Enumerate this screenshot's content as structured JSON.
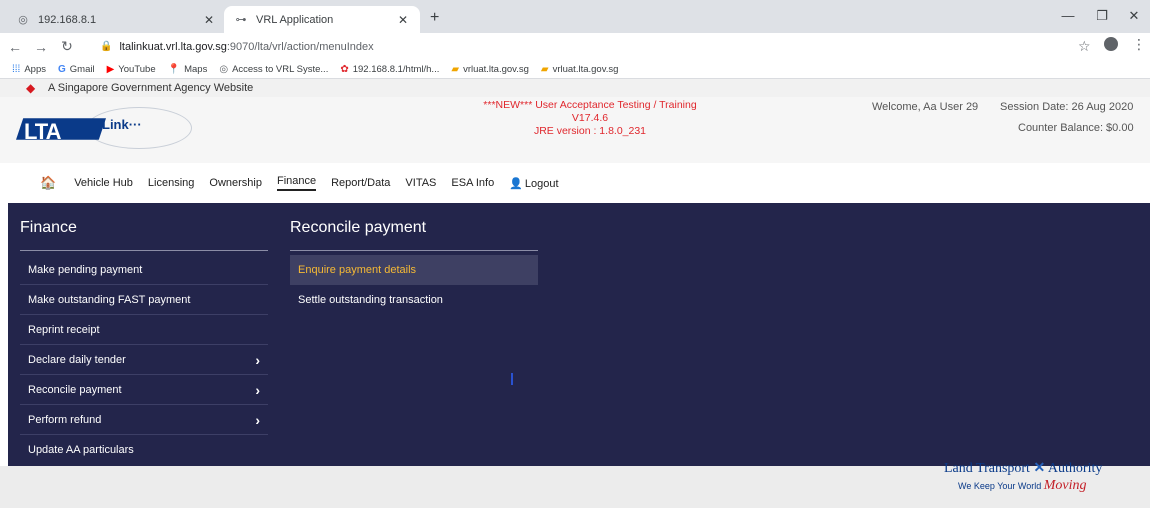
{
  "browser": {
    "tabs": [
      {
        "title": "192.168.8.1",
        "icon": "globe-icon"
      },
      {
        "title": "VRL Application",
        "icon": "key-icon"
      }
    ],
    "url_host": "ltalinkuat.vrl.lta.gov.sg",
    "url_path": ":9070/lta/vrl/action/menuIndex",
    "bookmarks": [
      {
        "label": "Apps",
        "icon": "apps-grid-icon"
      },
      {
        "label": "Gmail",
        "icon": "google-icon"
      },
      {
        "label": "YouTube",
        "icon": "youtube-icon"
      },
      {
        "label": "Maps",
        "icon": "maps-icon"
      },
      {
        "label": "Access to VRL Syste...",
        "icon": "globe-icon"
      },
      {
        "label": "192.168.8.1/html/h...",
        "icon": "huawei-icon"
      },
      {
        "label": "vrluat.lta.gov.sg",
        "icon": "lta-icon"
      },
      {
        "label": "vrluat.lta.gov.sg",
        "icon": "lta-icon"
      }
    ]
  },
  "header": {
    "gov_banner": "A Singapore Government Agency Website",
    "logo_text": "LTA",
    "logo_link": "Link···",
    "notice_line1": "***NEW*** User Acceptance Testing / Training",
    "notice_line2": "V17.4.6",
    "notice_line3": "JRE version : 1.8.0_231",
    "welcome": "Welcome, Aa User 29",
    "session_date": "Session Date: 26 Aug 2020",
    "counter_balance": "Counter Balance: $0.00"
  },
  "nav": {
    "items": [
      "Vehicle Hub",
      "Licensing",
      "Ownership",
      "Finance",
      "Report/Data",
      "VITAS",
      "ESA Info"
    ],
    "active": "Finance",
    "logout": "Logout"
  },
  "finance": {
    "title": "Finance",
    "items": [
      {
        "label": "Make pending payment",
        "has_submenu": false
      },
      {
        "label": "Make outstanding FAST payment",
        "has_submenu": false
      },
      {
        "label": "Reprint receipt",
        "has_submenu": false
      },
      {
        "label": "Declare daily tender",
        "has_submenu": true
      },
      {
        "label": "Reconcile payment",
        "has_submenu": true
      },
      {
        "label": "Perform refund",
        "has_submenu": true
      },
      {
        "label": "Update AA particulars",
        "has_submenu": false
      }
    ]
  },
  "reconcile": {
    "title": "Reconcile payment",
    "items": [
      {
        "label": "Enquire payment details",
        "selected": true
      },
      {
        "label": "Settle outstanding transaction",
        "selected": false
      }
    ]
  },
  "footer": {
    "authority_a": "Land Transport",
    "authority_b": "Authority",
    "slogan": "We Keep Your World",
    "slogan_highlight": "Moving"
  },
  "colors": {
    "panel_bg": "#23254b",
    "highlight": "#f5b935",
    "notice": "#e0272d"
  }
}
